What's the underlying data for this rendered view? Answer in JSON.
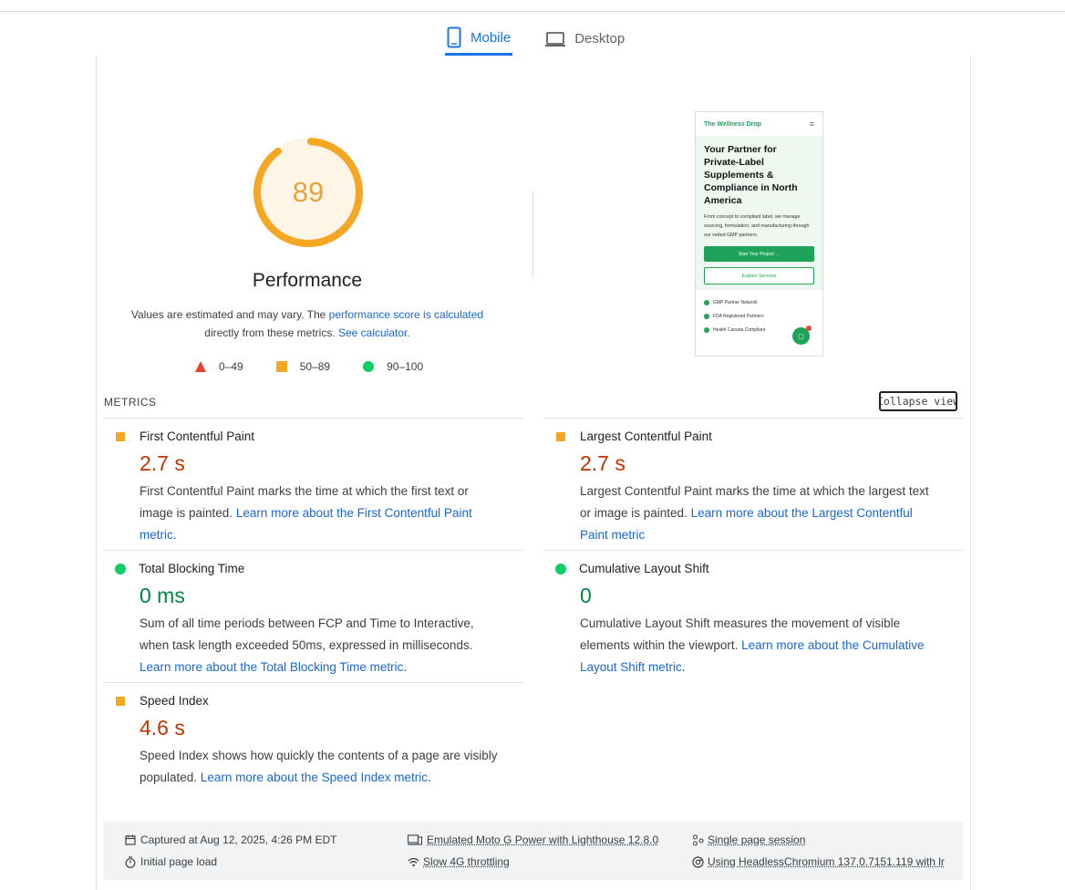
{
  "tabs": [
    {
      "label": "Mobile",
      "active": true,
      "icon": "phone-icon"
    },
    {
      "label": "Desktop",
      "active": false,
      "icon": "laptop-icon"
    }
  ],
  "performance": {
    "score": 89,
    "score_fraction": 0.89,
    "title": "Performance",
    "desc_prefix": "Values are estimated and may vary. The ",
    "desc_link1": "performance score is calculated",
    "desc_mid": "directly from these metrics. ",
    "desc_link2": "See calculator.",
    "color": "#f5a623"
  },
  "legend": [
    {
      "range": "0–49",
      "shape": "triangle",
      "color": "#eb3f2f"
    },
    {
      "range": "50–89",
      "shape": "square",
      "color": "#f5a623"
    },
    {
      "range": "90–100",
      "shape": "circle",
      "color": "#0cce6b"
    }
  ],
  "screenshot": {
    "brand": "The Wellness Drop",
    "menu_icon": "hamburger-icon",
    "headline": "Your Partner for Private-Label Supplements & Compliance in North America",
    "paragraph": "From concept to compliant label, we manage sourcing, formulation, and manufacturing through our vetted GMP partners.",
    "primary_button": "Start Your Project →",
    "secondary_button": "Explore Services",
    "checks": [
      "GMP Partner Network",
      "FDA Registered Partners",
      "Health Canada Compliant"
    ]
  },
  "metrics_section": {
    "title": "METRICS",
    "collapse_label": "Collapse view"
  },
  "metrics": [
    {
      "name": "First Contentful Paint",
      "value": "2.7 s",
      "status": "orange",
      "desc": "First Contentful Paint marks the time at which the first text or image is painted. ",
      "link": "Learn more about the First Contentful Paint metric",
      "suffix": "."
    },
    {
      "name": "Largest Contentful Paint",
      "value": "2.7 s",
      "status": "orange",
      "desc": "Largest Contentful Paint marks the time at which the largest text or image is painted. ",
      "link": "Learn more about the Largest Contentful Paint metric",
      "suffix": ""
    },
    {
      "name": "Total Blocking Time",
      "value": "0 ms",
      "status": "green",
      "desc": "Sum of all time periods between FCP and Time to Interactive, when task length exceeded 50ms, expressed in milliseconds. ",
      "link": "Learn more about the Total Blocking Time metric",
      "suffix": "."
    },
    {
      "name": "Cumulative Layout Shift",
      "value": "0",
      "status": "green",
      "desc": "Cumulative Layout Shift measures the movement of visible elements within the viewport. ",
      "link": "Learn more about the Cumulative Layout Shift metric",
      "suffix": "."
    },
    {
      "name": "Speed Index",
      "value": "4.6 s",
      "status": "orange",
      "desc": "Speed Index shows how quickly the contents of a page are visibly populated. ",
      "link": "Learn more about the Speed Index metric",
      "suffix": "."
    }
  ],
  "footer": {
    "captured": "Captured at Aug 12, 2025, 4:26 PM EDT",
    "load": "Initial page load",
    "device": "Emulated Moto G Power with Lighthouse 12.8.0",
    "throttling": "Slow 4G throttling",
    "session": "Single page session",
    "browser": "Using HeadlessChromium 137.0.7151.119 with lr"
  }
}
